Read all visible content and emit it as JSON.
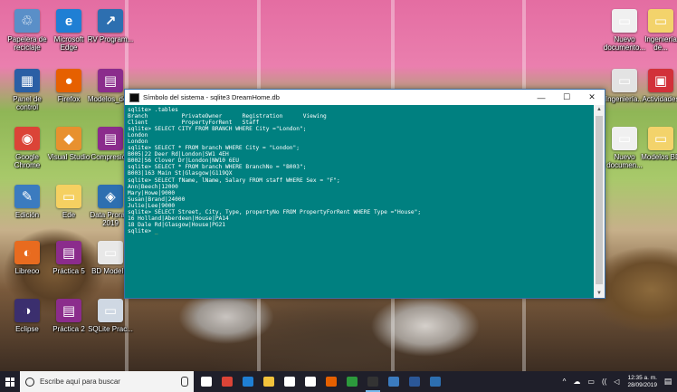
{
  "desktop": {
    "icons_left": [
      {
        "label": "Papelera de reciclaje",
        "color": "#5a8fc8",
        "glyph": "♲"
      },
      {
        "label": "Microsoft Edge",
        "color": "#1f7fd4",
        "glyph": "e"
      },
      {
        "label": "RV Program...",
        "color": "#2d6fb0",
        "glyph": "↗"
      },
      {
        "label": "Panel de control",
        "color": "#2b5fa5",
        "glyph": "▦"
      },
      {
        "label": "Firefox",
        "color": "#e66000",
        "glyph": "●"
      },
      {
        "label": "Modelos_de...",
        "color": "#8b2c8c",
        "glyph": "▤"
      },
      {
        "label": "Google Chrome",
        "color": "#db4437",
        "glyph": "◉"
      },
      {
        "label": "Visual Studio",
        "color": "#e8912f",
        "glyph": "◆"
      },
      {
        "label": "Compresión",
        "color": "#8b2c8c",
        "glyph": "▤"
      },
      {
        "label": "Edición",
        "color": "#3b7bbf",
        "glyph": "✎"
      },
      {
        "label": "Ede",
        "color": "#f5d061",
        "glyph": "▭"
      },
      {
        "label": "Data Proram 2019",
        "color": "#2d6fb0",
        "glyph": "◈"
      },
      {
        "label": "Libreoo",
        "color": "#e86b1f",
        "glyph": "◐"
      },
      {
        "label": "Práctica 5",
        "color": "#8b2c8c",
        "glyph": "▤"
      },
      {
        "label": "BD Model...",
        "color": "#e8e8e8",
        "glyph": "▭"
      },
      {
        "label": "Eclipse",
        "color": "#3b2f6e",
        "glyph": "◑"
      },
      {
        "label": "Práctica 2",
        "color": "#8b2c8c",
        "glyph": "▤"
      },
      {
        "label": "SQLite Prac...",
        "color": "#cfd8e3",
        "glyph": "▭"
      }
    ],
    "icons_right": [
      {
        "label": "Nuevo documento...",
        "color": "#f0f0f0",
        "glyph": "▭"
      },
      {
        "label": "Ingeniería de...",
        "color": "#f3d36b",
        "glyph": "▭"
      },
      {
        "label": "Ingeniería...",
        "color": "#e3e3e3",
        "glyph": "▭"
      },
      {
        "label": "Actividades",
        "color": "#d2313a",
        "glyph": "▣"
      },
      {
        "label": "Nuevo documen...",
        "color": "#f0f0f0",
        "glyph": "▭"
      },
      {
        "label": "Modelos BD",
        "color": "#f3d36b",
        "glyph": "▭"
      }
    ]
  },
  "window": {
    "title": "Símbolo del sistema - sqlite3 DreamHome.db",
    "minimize": "—",
    "maximize": "☐",
    "close": "✕",
    "console_lines": [
      "sqlite> .tables",
      "Branch          PrivateOwner      Registration      Viewing",
      "Client          PropertyForRent   Staff",
      "sqlite> SELECT CITY FROM BRANCH WHERE City =\"London\";",
      "London",
      "London",
      "sqlite> SELECT * FROM branch WHERE City = \"London\";",
      "B005|22 Deer Rd|London|SW1 4EH",
      "B002|56 Clover Dr|London|NW10 6EU",
      "sqlite> SELECT * FROM branch WHERE BranchNo = \"B003\";",
      "B003|163 Main St|Glasgow|G119QX",
      "sqlite> SELECT fName, lName, Salary FROM staff WHERE Sex = \"F\";",
      "Ann|Beech|12000",
      "Mary|Howe|9000",
      "Susan|Brand|24000",
      "Julie|Lee|9000",
      "sqlite> SELECT Street, City, Type, propertyNo FROM PropertyForRent WHERE Type =\"House\";",
      "16 Holland|Aberdeen|House|PA14",
      "18 Dale Rd|Glasgow|House|PG21"
    ],
    "prompt": "sqlite> ",
    "cursor": "_"
  },
  "taskbar": {
    "search_placeholder": "Escribe aquí para buscar",
    "apps": [
      {
        "name": "task-view",
        "color": "#ffffff"
      },
      {
        "name": "chrome",
        "color": "#db4437"
      },
      {
        "name": "edge",
        "color": "#1f7fd4"
      },
      {
        "name": "explorer",
        "color": "#f3c33c"
      },
      {
        "name": "store",
        "color": "#ffffff"
      },
      {
        "name": "mail",
        "color": "#ffffff"
      },
      {
        "name": "firefox",
        "color": "#e66000"
      },
      {
        "name": "project",
        "color": "#2c9a3c"
      },
      {
        "name": "cmd",
        "color": "#333333"
      },
      {
        "name": "app",
        "color": "#3b7bbf"
      },
      {
        "name": "word",
        "color": "#2b5797"
      },
      {
        "name": "photos",
        "color": "#2d6fb0"
      }
    ],
    "tray_icons": [
      "^",
      "☁",
      "▭",
      "((",
      "◁"
    ],
    "time": "12:35 a. m.",
    "date": "28/09/2019",
    "notification": "▤"
  }
}
